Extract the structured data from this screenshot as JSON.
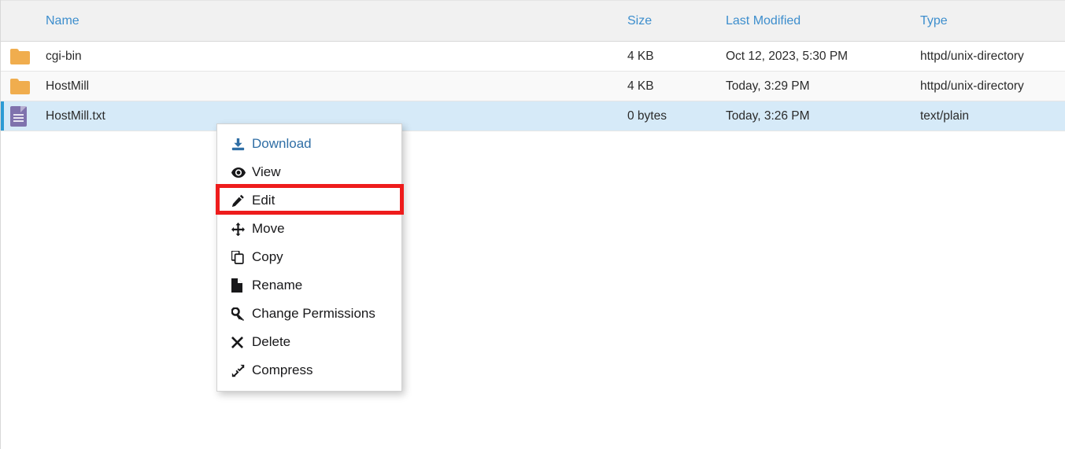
{
  "file_list": {
    "columns": [
      {
        "key": "name",
        "label": "Name"
      },
      {
        "key": "size",
        "label": "Size"
      },
      {
        "key": "modified",
        "label": "Last Modified"
      },
      {
        "key": "type",
        "label": "Type"
      }
    ],
    "rows": [
      {
        "icon": "folder-icon",
        "name": "cgi-bin",
        "size": "4 KB",
        "modified": "Oct 12, 2023, 5:30 PM",
        "type": "httpd/unix-directory",
        "selected": false
      },
      {
        "icon": "folder-icon",
        "name": "HostMill",
        "size": "4 KB",
        "modified": "Today, 3:29 PM",
        "type": "httpd/unix-directory",
        "selected": false
      },
      {
        "icon": "text-file-icon",
        "name": "HostMill.txt",
        "size": "0 bytes",
        "modified": "Today, 3:26 PM",
        "type": "text/plain",
        "selected": true
      }
    ]
  },
  "context_menu": {
    "items": [
      {
        "label": "Download",
        "icon": "download-icon",
        "style": "link"
      },
      {
        "label": "View",
        "icon": "eye-icon",
        "style": "default"
      },
      {
        "label": "Edit",
        "icon": "pencil-icon",
        "style": "default"
      },
      {
        "label": "Move",
        "icon": "arrows-move-icon",
        "style": "default"
      },
      {
        "label": "Copy",
        "icon": "copy-icon",
        "style": "default"
      },
      {
        "label": "Rename",
        "icon": "file-icon",
        "style": "default"
      },
      {
        "label": "Change Permissions",
        "icon": "key-icon",
        "style": "default"
      },
      {
        "label": "Delete",
        "icon": "times-icon",
        "style": "default"
      },
      {
        "label": "Compress",
        "icon": "compress-icon",
        "style": "default"
      }
    ],
    "highlighted_item": "Edit"
  },
  "colors": {
    "header_link": "#3d8ecd",
    "selected_row": "#d6eaf8",
    "selected_accent": "#2d9bd4",
    "folder": "#f0ad4e",
    "text_file": "#7f72ad",
    "menu_link": "#2f6ea5",
    "highlight_box": "#ee1c1c"
  }
}
